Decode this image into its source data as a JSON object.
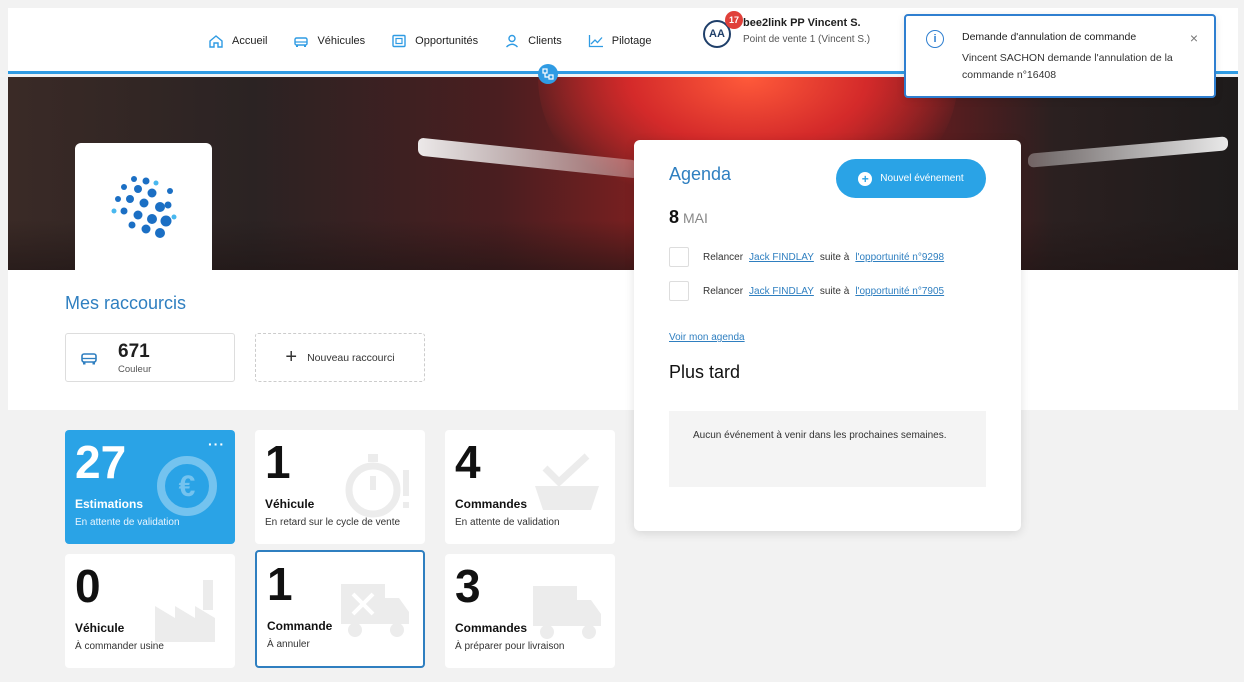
{
  "nav": {
    "items": [
      {
        "label": "Accueil",
        "icon": "home-icon"
      },
      {
        "label": "Véhicules",
        "icon": "car-icon"
      },
      {
        "label": "Opportunités",
        "icon": "opportunity-icon"
      },
      {
        "label": "Clients",
        "icon": "user-icon"
      },
      {
        "label": "Pilotage",
        "icon": "chart-line-icon"
      }
    ],
    "avatar_initials": "AA",
    "badge_count": "17",
    "user_name": "bee2link PP Vincent S.",
    "user_location": "Point de vente 1 (Vincent S.)"
  },
  "toast": {
    "title": "Demande d'annulation de commande",
    "body": "Vincent SACHON demande l'annulation de la commande n°16408",
    "close": "×"
  },
  "shortcuts": {
    "title": "Mes raccourcis",
    "card": {
      "value": "671",
      "label": "Couleur"
    },
    "new_label": "Nouveau raccourci"
  },
  "tiles": [
    {
      "value": "27",
      "label": "Estimations",
      "sub": "En attente de validation",
      "icon": "euro-refresh-icon",
      "active": true,
      "menu": "···"
    },
    {
      "value": "1",
      "label": "Véhicule",
      "sub": "En retard sur le cycle de vente",
      "icon": "stopwatch-icon"
    },
    {
      "value": "4",
      "label": "Commandes",
      "sub": "En attente de validation",
      "icon": "cart-check-icon"
    },
    {
      "value": "0",
      "label": "Véhicule",
      "sub": "À commander usine",
      "icon": "factory-icon"
    },
    {
      "value": "1",
      "label": "Commande",
      "sub": "À annuler",
      "icon": "truck-cancel-icon",
      "selected": true
    },
    {
      "value": "3",
      "label": "Commandes",
      "sub": "À préparer pour livraison",
      "icon": "truck-icon"
    }
  ],
  "agenda": {
    "title": "Agenda",
    "new_event": "Nouvel événement",
    "day": "8",
    "month": "MAI",
    "tasks": [
      {
        "prefix": "Relancer",
        "person": "Jack FINDLAY",
        "middle": "suite à",
        "link": "l'opportunité n°9298"
      },
      {
        "prefix": "Relancer",
        "person": "Jack FINDLAY",
        "middle": "suite à",
        "link": "l'opportunité n°7905"
      }
    ],
    "see_all": "Voir mon agenda",
    "later_title": "Plus tard",
    "empty_text": "Aucun événement à venir dans les prochaines semaines."
  },
  "colors": {
    "accent": "#2aa3e6",
    "link": "#2f7fc0",
    "badge": "#e0403a"
  }
}
